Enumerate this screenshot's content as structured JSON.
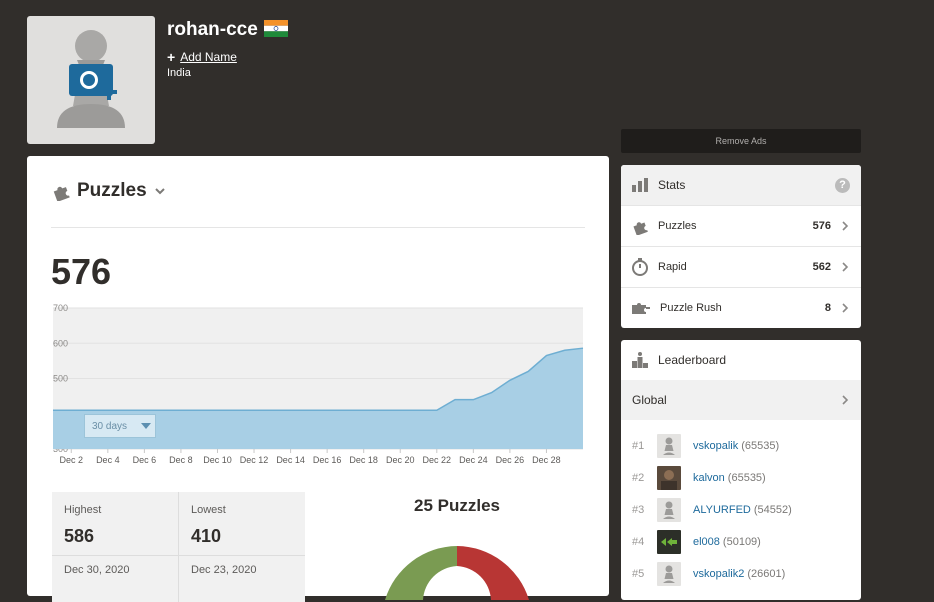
{
  "profile": {
    "username": "rohan-cce",
    "add_name_label": "Add Name",
    "country": "India"
  },
  "remove_ads_label": "Remove Ads",
  "main": {
    "title": "Puzzles",
    "rating": "576",
    "range_label": "30 days",
    "highest_label": "Highest",
    "highest_value": "586",
    "highest_date": "Dec 30, 2020",
    "lowest_label": "Lowest",
    "lowest_value": "410",
    "lowest_date": "Dec 23, 2020",
    "puzzles_count_label": "25 Puzzles"
  },
  "chart_data": {
    "type": "area",
    "ylim": [
      300,
      700
    ],
    "y_ticks": [
      "700",
      "600",
      "500",
      "400",
      "300"
    ],
    "x_tick_labels": [
      "Dec 2",
      "Dec 4",
      "Dec 6",
      "Dec 8",
      "Dec 10",
      "Dec 12",
      "Dec 14",
      "Dec 16",
      "Dec 18",
      "Dec 20",
      "Dec 22",
      "Dec 24",
      "Dec 26",
      "Dec 28"
    ],
    "x": [
      1,
      22,
      23,
      24,
      25,
      26,
      27,
      28,
      29,
      30
    ],
    "values": [
      410,
      410,
      440,
      440,
      460,
      495,
      520,
      565,
      580,
      586
    ],
    "grid": true
  },
  "donut_data": {
    "colors": [
      "#7a9b52",
      "#b83634"
    ]
  },
  "stats": {
    "title": "Stats",
    "help": "?",
    "rows": [
      {
        "name": "Puzzles",
        "value": "576"
      },
      {
        "name": "Rapid",
        "value": "562"
      },
      {
        "name": "Puzzle Rush",
        "value": "8"
      }
    ]
  },
  "leaderboard": {
    "title": "Leaderboard",
    "scope": "Global",
    "entries": [
      {
        "rank": "#1",
        "name": "vskopalik",
        "score": "(65535)"
      },
      {
        "rank": "#2",
        "name": "kalvon",
        "score": "(65535)"
      },
      {
        "rank": "#3",
        "name": "ALYURFED",
        "score": "(54552)"
      },
      {
        "rank": "#4",
        "name": "el008",
        "score": "(50109)"
      },
      {
        "rank": "#5",
        "name": "vskopalik2",
        "score": "(26601)"
      }
    ]
  },
  "colors": {
    "background": "#312e2b",
    "chart_fill": "#a8cfe5",
    "chart_line": "#6eaed2",
    "link": "#1e6a9c"
  }
}
